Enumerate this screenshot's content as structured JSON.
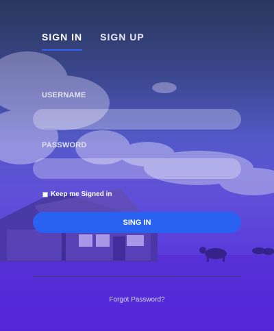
{
  "tabs": [
    {
      "label": "SIGN IN",
      "active": true
    },
    {
      "label": "SIGN UP",
      "active": false
    }
  ],
  "form": {
    "username_label": "USERNAME",
    "username_value": "",
    "password_label": "PASSWORD",
    "password_value": "",
    "keep_signed_in_label": "Keep me Signed in",
    "keep_signed_in_checked": false,
    "submit_label": "SING IN",
    "forgot_label": "Forgot Password?"
  },
  "colors": {
    "accent": "#2961f0",
    "tab_underline": "#2f62f5"
  }
}
